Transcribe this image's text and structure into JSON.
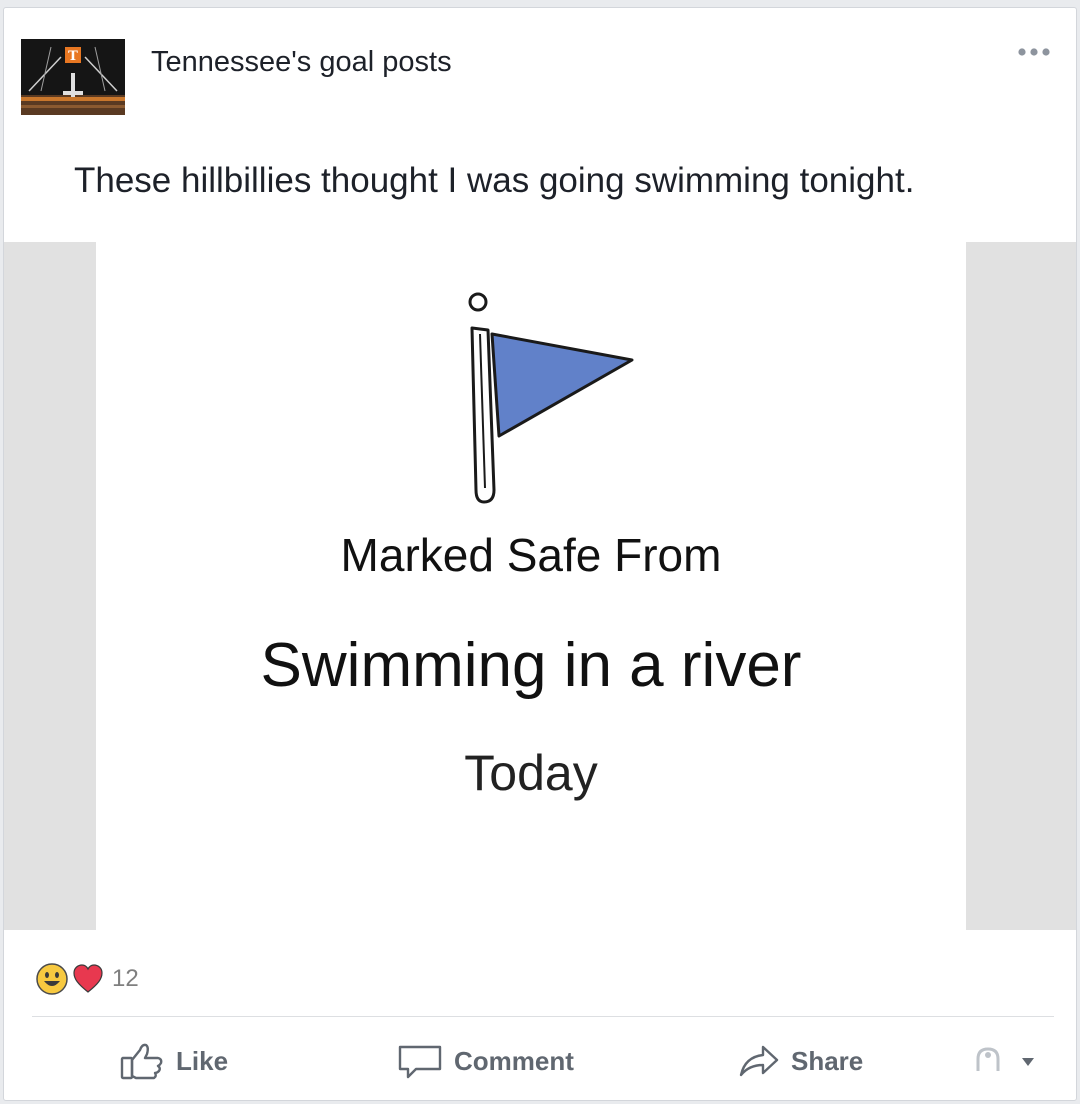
{
  "post": {
    "page_name": "Tennessee's goal posts",
    "text": "These hillbillies thought I was going swimming tonight.",
    "avatar_letter": "T",
    "more_icon": "more-dots-icon"
  },
  "meme": {
    "icon": "safety-check-flag-icon",
    "flag_color": "#6181c9",
    "line1": "Marked Safe From",
    "line2": "Swimming in a river",
    "line3": "Today"
  },
  "reactions": {
    "icons": [
      "haha-reaction-icon",
      "love-reaction-icon"
    ],
    "count": "12"
  },
  "actions": {
    "like": "Like",
    "comment": "Comment",
    "share": "Share",
    "audience_icon": "audience-selector-icon"
  },
  "colors": {
    "love": "#e8384f",
    "haha": "#f7c940",
    "action_text": "#606770"
  }
}
